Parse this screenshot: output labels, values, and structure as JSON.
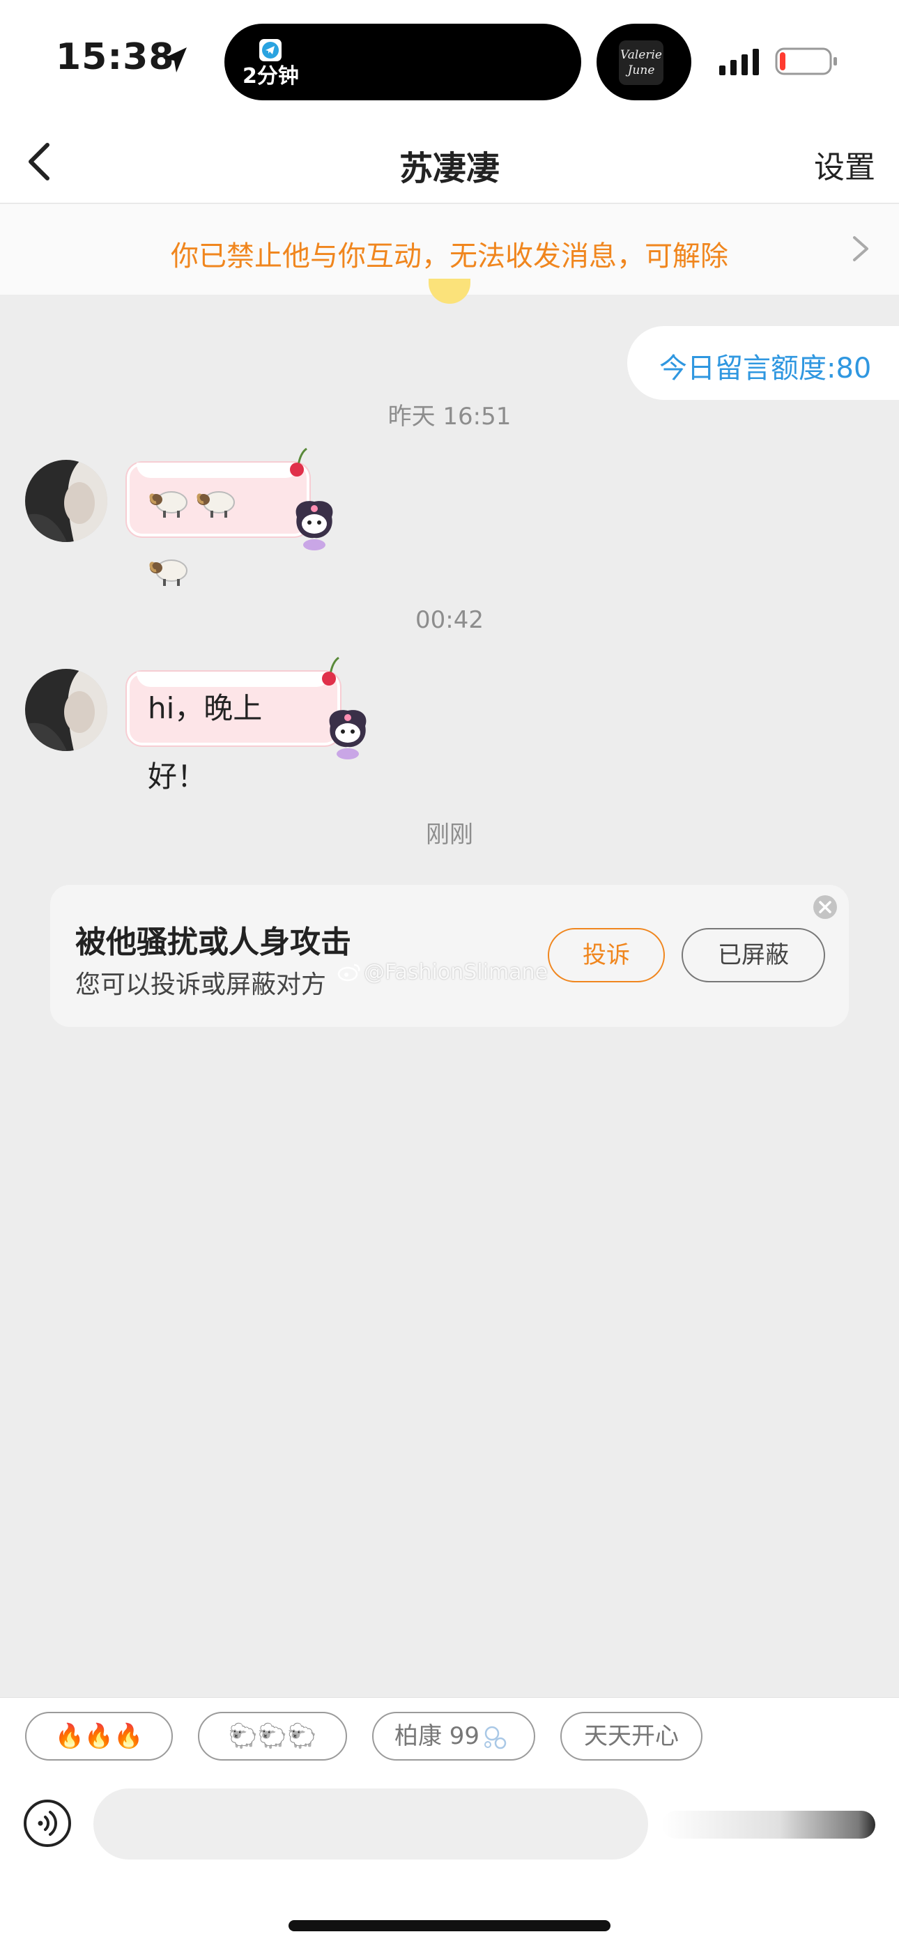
{
  "status_bar": {
    "time": "15:38",
    "island_text": "2分钟",
    "album_art_text": "Valerie June",
    "battery_level": 0.12,
    "colors": {
      "battery_low": "#ff3b30"
    }
  },
  "nav": {
    "title": "苏凄凄",
    "settings_label": "设置"
  },
  "banner": {
    "text": "你已禁止他与你互动，无法收发消息，可解除",
    "color": "#f0861e"
  },
  "quota": {
    "text": "今日留言额度:80",
    "color": "#2f97e0"
  },
  "messages": [
    {
      "timestamp": "昨天 16:51",
      "content_type": "emoji",
      "content": "🐏🐏🐏"
    },
    {
      "timestamp": "00:42",
      "content_type": "text",
      "content": "hi，晚上好！"
    }
  ],
  "report_card": {
    "timestamp": "刚刚",
    "title": "被他骚扰或人身攻击",
    "subtitle": "您可以投诉或屏蔽对方",
    "report_label": "投诉",
    "blocked_label": "已屏蔽"
  },
  "watermark": "@FashionSlimane",
  "quick_replies": [
    {
      "text": "🔥🔥🔥"
    },
    {
      "text": "🐑🐑🐑"
    },
    {
      "prefix": "柏康 99",
      "text": "柏康 99🫧"
    },
    {
      "text": "天天开心"
    }
  ],
  "input": {
    "value": "",
    "placeholder": ""
  },
  "icons": {
    "back": "chevron-left-icon",
    "banner_arrow": "chevron-right-icon",
    "voice": "voice-icon",
    "close": "close-circle-icon",
    "location": "location-arrow-icon"
  }
}
